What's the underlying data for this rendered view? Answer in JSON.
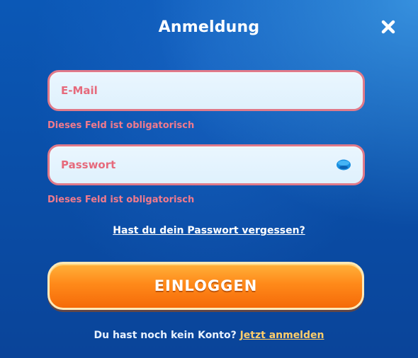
{
  "dialog": {
    "title": "Anmeldung"
  },
  "form": {
    "email": {
      "placeholder": "E-Mail",
      "value": "",
      "error": "Dieses Feld ist obligatorisch"
    },
    "password": {
      "placeholder": "Passwort",
      "value": "",
      "error": "Dieses Feld ist obligatorisch"
    },
    "forgot_password_link": "Hast du dein Passwort vergessen?",
    "login_button": "EINLOGGEN",
    "signup_prompt": "Du hast noch kein Konto? ",
    "signup_link": "Jetzt anmelden"
  },
  "icons": {
    "close": "close-icon",
    "show_password": "eye-icon"
  },
  "colors": {
    "background": "#0a4fa9",
    "error": "#f07a8c",
    "field_border": "#e07a8a",
    "button_orange": "#ff8a1a",
    "signup_link": "#ffce6a"
  }
}
